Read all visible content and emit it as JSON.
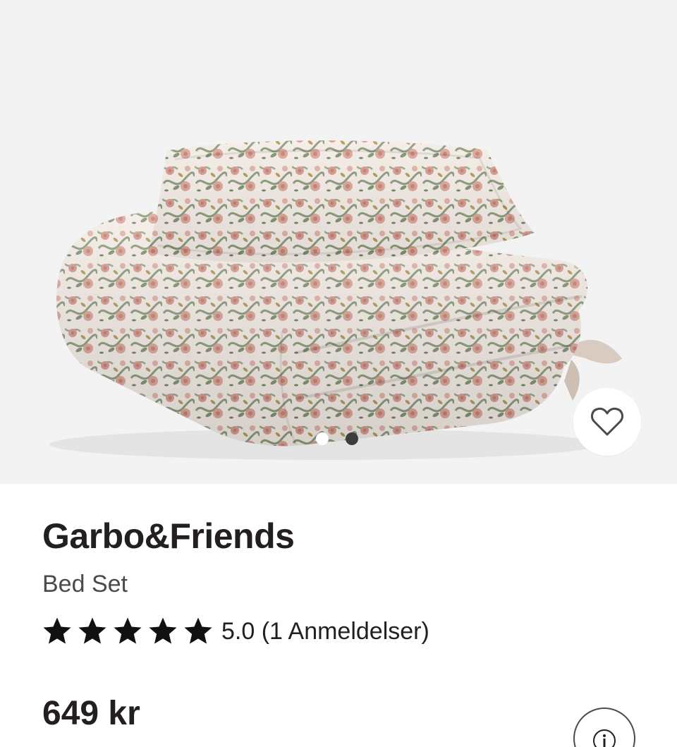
{
  "product": {
    "brand": "Garbo&Friends",
    "name": "Bed Set",
    "rating_text": "5.0 (1 Anmeldelser)",
    "rating_value": 5,
    "rating_max": 5,
    "price": "649 kr"
  },
  "gallery": {
    "image_count": 2,
    "active_index": 1
  },
  "icons": {
    "favorite": "heart-icon",
    "info": "info-icon",
    "star": "star-icon"
  },
  "colors": {
    "text": "#231f20",
    "secondary_text": "#4a4a4a",
    "hero_background": "#f3f3f3",
    "fabric_pink": "#d69a8e",
    "fabric_green": "#8a9a7a"
  }
}
